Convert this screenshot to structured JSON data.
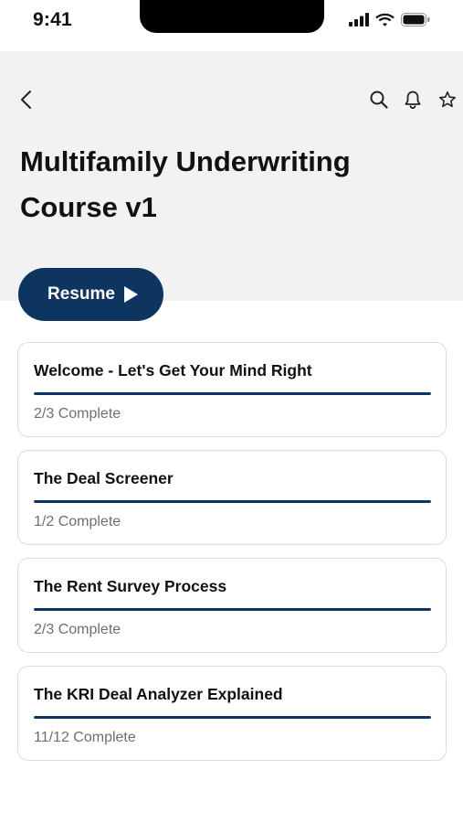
{
  "status_bar": {
    "time": "9:41",
    "icons": [
      "cellular-signal-icon",
      "wifi-icon",
      "battery-icon"
    ]
  },
  "header": {
    "icons": {
      "back": "chevron-left-icon",
      "search": "search-icon",
      "notifications": "bell-icon",
      "favorite": "star-icon"
    },
    "title": "Multifamily Underwriting Course v1"
  },
  "resume_button": {
    "label": "Resume",
    "icon": "play-icon"
  },
  "colors": {
    "accent": "#0d3560",
    "header_background": "#f2f2f2",
    "muted_text": "#6f6f6f"
  },
  "modules": [
    {
      "title": "Welcome - Let's Get Your Mind Right",
      "status": "2/3 Complete",
      "progress": 1.0
    },
    {
      "title": "The Deal Screener",
      "status": "1/2 Complete",
      "progress": 1.0
    },
    {
      "title": "The Rent Survey Process",
      "status": "2/3 Complete",
      "progress": 1.0
    },
    {
      "title": "The KRI Deal Analyzer Explained",
      "status": "11/12 Complete",
      "progress": 1.0
    }
  ]
}
